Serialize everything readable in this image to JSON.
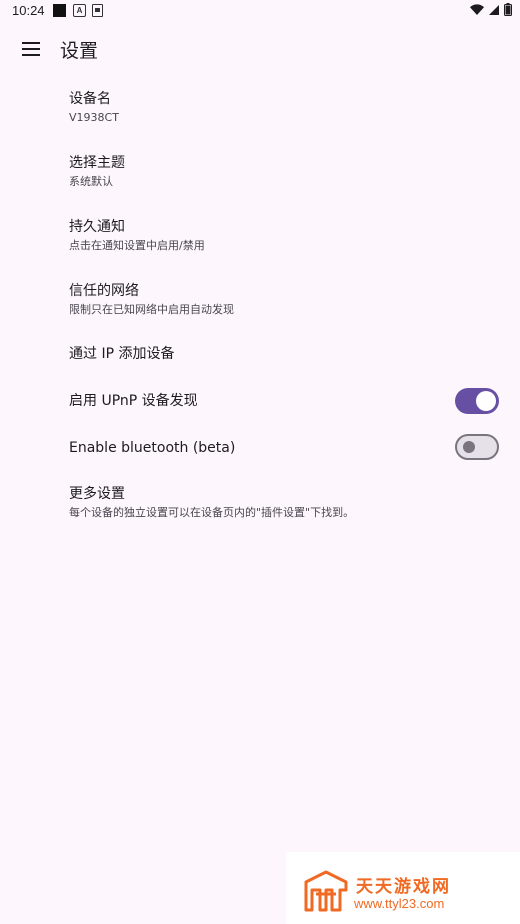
{
  "status_bar": {
    "time": "10:24",
    "notif_a_glyph": "A"
  },
  "app_bar": {
    "title": "设置"
  },
  "preferences": [
    {
      "title": "设备名",
      "summary": "V1938CT"
    },
    {
      "title": "选择主题",
      "summary": "系统默认"
    },
    {
      "title": "持久通知",
      "summary": "点击在通知设置中启用/禁用"
    },
    {
      "title": "信任的网络",
      "summary": "限制只在已知网络中启用自动发现"
    },
    {
      "title": "通过 IP 添加设备"
    },
    {
      "title": "启用 UPnP 设备发现",
      "switch_on": true
    },
    {
      "title": "Enable bluetooth (beta)",
      "switch_on": false
    },
    {
      "title": "更多设置",
      "summary": "每个设备的独立设置可以在设备页内的\"插件设置\"下找到。"
    }
  ],
  "watermark": {
    "logo_text": "天天游戏网",
    "url": "www.ttyl23.com"
  },
  "colors": {
    "background": "#fdf7fd",
    "accent": "#6750a4",
    "switch_off_track": "#e6e0e9",
    "switch_off_outline": "#79747e",
    "watermark_orange": "#f06a23"
  },
  "icons": {
    "menu": "menu-icon",
    "wifi": "wifi-icon",
    "signal": "signal-icon",
    "battery": "battery-icon"
  }
}
